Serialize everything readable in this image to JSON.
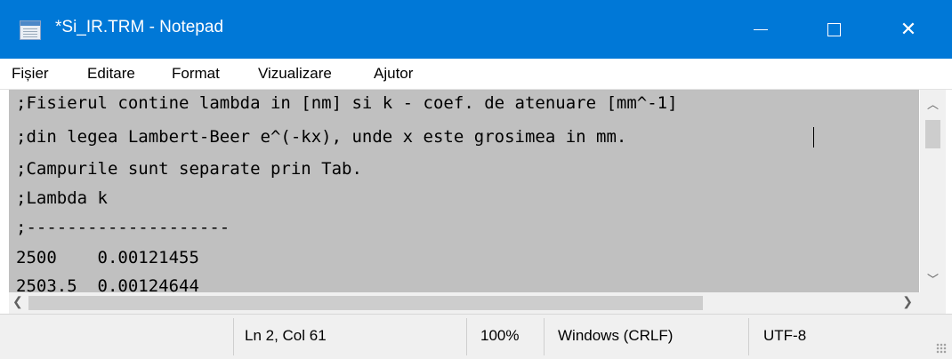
{
  "window": {
    "title": "*Si_IR.TRM - Notepad",
    "icon": "notepad-icon"
  },
  "menu": [
    "Fișier",
    "Editare",
    "Format",
    "Vizualizare",
    "Ajutor"
  ],
  "editor": {
    "lines": [
      ";Fisierul contine lambda in [nm] si k - coef. de atenuare [mm^-1]",
      ";din legea Lambert-Beer e^(-kx), unde x este grosimea in mm.",
      ";Campurile sunt separate prin Tab.",
      ";Lambda k",
      ";--------------------",
      "2500    0.00121455",
      "2503.5  0.00124644"
    ],
    "selection_color": "#c0c0c0"
  },
  "status": {
    "position": "Ln 2, Col 61",
    "zoom": "100%",
    "line_ending": "Windows (CRLF)",
    "encoding": "UTF-8"
  },
  "colors": {
    "titlebar": "#0078d7"
  }
}
